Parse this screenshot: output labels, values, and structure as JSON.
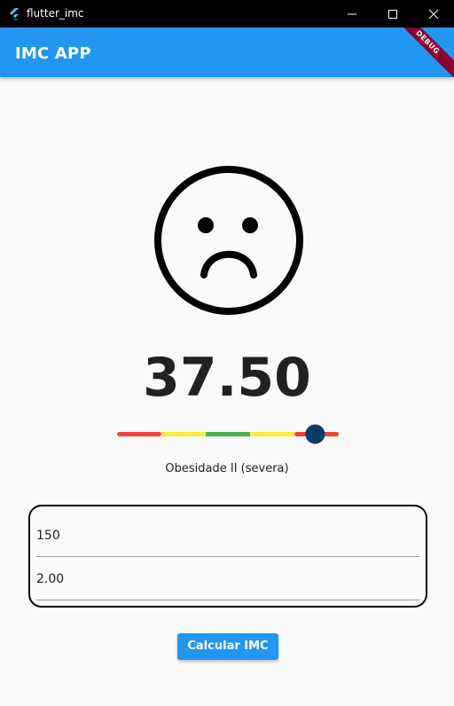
{
  "window": {
    "title": "flutter_imc",
    "app_icon": "flutter-logo-icon",
    "controls": [
      "minimize-icon",
      "maximize-icon",
      "close-icon"
    ]
  },
  "appbar": {
    "title": "IMC APP",
    "debug_banner": "DEBUG",
    "color": "#2196f3"
  },
  "result": {
    "face_icon": "sad-face-icon",
    "bmi": "37.50",
    "classification": "Obesidade II (severa)"
  },
  "scale": {
    "segment_colors": [
      "#f44336",
      "#ffeb3b",
      "#4caf50",
      "#ffeb3b",
      "#f44336"
    ],
    "thumb_color": "#0d3a6b",
    "thumb_position": 0.9
  },
  "form": {
    "weight_value": "150",
    "height_value": "2.00"
  },
  "actions": {
    "calculate_label": "Calcular IMC"
  }
}
